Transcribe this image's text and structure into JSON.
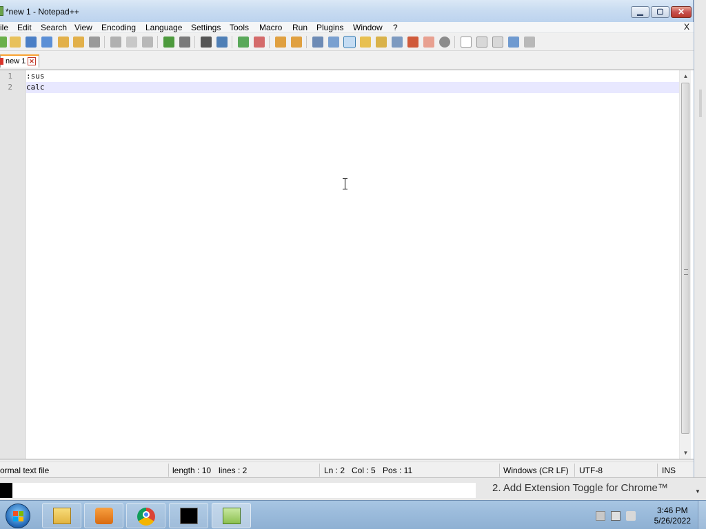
{
  "window": {
    "title": "*new 1 - Notepad++",
    "minimize_glyph": "▁",
    "maximize_glyph": "▢",
    "close_glyph": "✕"
  },
  "menu": {
    "items": [
      "ile",
      "Edit",
      "Search",
      "View",
      "Encoding",
      "Language",
      "Settings",
      "Tools",
      "Macro",
      "Run",
      "Plugins",
      "Window",
      "?"
    ],
    "close_label": "X"
  },
  "toolbar": {
    "icons": [
      "new-file-icon",
      "open-file-icon",
      "save-icon",
      "save-all-icon",
      "close-icon",
      "close-all-icon",
      "print-icon",
      "cut-icon",
      "copy-icon",
      "paste-icon",
      "undo-icon",
      "redo-icon",
      "find-icon",
      "replace-icon",
      "zoom-in-icon",
      "zoom-out-icon",
      "sync-vertical-icon",
      "sync-horizontal-icon",
      "word-wrap-icon",
      "show-all-chars-icon",
      "indent-guide-icon",
      "user-language-icon",
      "doc-map-icon",
      "function-list-icon",
      "folder-workspace-icon",
      "monitoring-icon",
      "record-macro-icon",
      "stop-macro-icon",
      "play-macro-icon",
      "run-macro-multiple-icon",
      "save-macro-icon"
    ],
    "colors": {
      "selected": "#c4dcf3",
      "accent": "#3c7fb1"
    }
  },
  "tabs": [
    {
      "label": "new 1",
      "close_glyph": "✕",
      "active": true
    }
  ],
  "editor": {
    "lines": [
      {
        "number": "1",
        "text": ":sus"
      },
      {
        "number": "2",
        "text": "calc"
      }
    ],
    "current_line_color": "#e8e8ff",
    "scroll_up_glyph": "▲",
    "scroll_down_glyph": "▼"
  },
  "status": {
    "file_type": "ormal text file",
    "length": "length : 10",
    "lines": "lines : 2",
    "ln": "Ln : 2",
    "col": "Col : 5",
    "pos": "Pos : 11",
    "eol": "Windows (CR LF)",
    "encoding": "UTF-8",
    "mode": "INS"
  },
  "background_page": {
    "text": "2. Add Extension Toggle for Chrome™",
    "down_glyph": "▼"
  },
  "taskbar": {
    "apps": [
      "file-explorer-icon",
      "media-player-icon",
      "chrome-icon",
      "command-prompt-icon",
      "notepad-plus-plus-icon"
    ],
    "time": "3:46 PM",
    "date": "5/26/2022",
    "tray_icons": [
      "action-center-icon",
      "network-icon",
      "volume-icon"
    ]
  }
}
